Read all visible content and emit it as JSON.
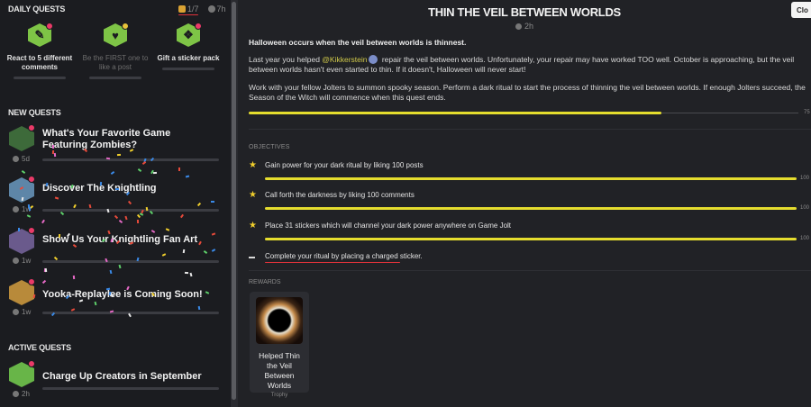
{
  "daily_quests": {
    "heading": "DAILY QUESTS",
    "gift_count": "1/7",
    "time_left": "7h",
    "items": [
      {
        "label": "React to 5 different comments",
        "icon": "chat-bubble-icon",
        "badge": "dot"
      },
      {
        "label": "Be the FIRST one to like a post",
        "icon": "heart-icon",
        "badge": "check"
      },
      {
        "label": "Gift a sticker pack",
        "icon": "sticker-pack-icon",
        "badge": "dot"
      }
    ]
  },
  "new_quests": {
    "heading": "NEW QUESTS",
    "items": [
      {
        "title": "What's Your Favorite Game Featuring Zombies?",
        "time": "5d"
      },
      {
        "title": "Discover The Knightling",
        "time": "1w"
      },
      {
        "title": "Show Us Your Knightling Fan Art",
        "time": "1w"
      },
      {
        "title": "Yooka-Replaylee is Coming Soon!",
        "time": "1w"
      }
    ]
  },
  "active_quests": {
    "heading": "ACTIVE QUESTS",
    "items": [
      {
        "title": "Charge Up Creators in September",
        "time": "2h"
      }
    ]
  },
  "quest_detail": {
    "title": "THIN THE VEIL BETWEEN WORLDS",
    "time": "2h",
    "close_label": "Clo",
    "intro": "Halloween occurs when the veil between worlds is thinnest.",
    "para1_before": "Last year you helped ",
    "mention": "@Kikkerstein",
    "para1_after": " repair the veil between worlds. Unfortunately, your repair may have worked TOO well. October is approaching, but the veil between worlds hasn't even started to thin. If it doesn't, Halloween will never start!",
    "para2": "Work with your fellow Jolters to summon spooky season. Perform a dark ritual to start the process of thinning the veil between worlds. If enough Jolters succeed, the Season of the Witch will commence when this quest ends.",
    "progress_fraction": 0.75,
    "progress_label": "75",
    "objectives_heading": "OBJECTIVES",
    "objectives": [
      {
        "text": "Gain power for your dark ritual by liking 100 posts",
        "status": "complete",
        "pct": "100"
      },
      {
        "text": "Call forth the darkness by liking 100 comments",
        "status": "complete",
        "pct": "100"
      },
      {
        "text": "Place 31 stickers which will channel your dark power anywhere on Game Jolt",
        "status": "complete",
        "pct": "100"
      },
      {
        "text": "Complete your ritual by placing a charged sticker.",
        "status": "incomplete"
      }
    ],
    "rewards_heading": "REWARDS",
    "reward": {
      "name": "Helped Thin the Veil Between Worlds",
      "type": "Trophy"
    }
  },
  "colors": {
    "progress": "#e5dd2e",
    "accent_red": "#e0323a",
    "star": "#f1cf2c"
  }
}
